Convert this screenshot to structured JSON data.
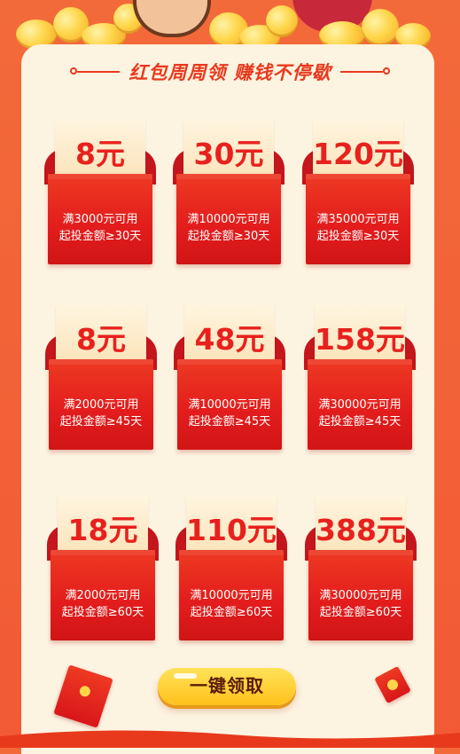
{
  "header": {
    "title": "红包周周领 赚钱不停歇"
  },
  "packets": [
    {
      "amount": "8元",
      "line1": "满3000元可用",
      "line2": "起投金额≥30天"
    },
    {
      "amount": "30元",
      "line1": "满10000元可用",
      "line2": "起投金额≥30天"
    },
    {
      "amount": "120元",
      "line1": "满35000元可用",
      "line2": "起投金额≥30天"
    },
    {
      "amount": "8元",
      "line1": "满2000元可用",
      "line2": "起投金额≥45天"
    },
    {
      "amount": "48元",
      "line1": "满10000元可用",
      "line2": "起投金额≥45天"
    },
    {
      "amount": "158元",
      "line1": "满30000元可用",
      "line2": "起投金额≥45天"
    },
    {
      "amount": "18元",
      "line1": "满2000元可用",
      "line2": "起投金额≥60天"
    },
    {
      "amount": "110元",
      "line1": "满10000元可用",
      "line2": "起投金额≥60天"
    },
    {
      "amount": "388元",
      "line1": "满30000元可用",
      "line2": "起投金额≥60天"
    }
  ],
  "actions": {
    "claim_label": "一键领取"
  },
  "colors": {
    "background": "#f15a35",
    "card": "#fdf3e1",
    "packet_red": "#e21c1c",
    "amount_red": "#e8211d",
    "button_yellow": "#ffc21b"
  },
  "icons": {
    "decor_left": "red-envelope-icon",
    "decor_right": "red-envelope-icon",
    "top_banner": "gold-coins-icon"
  }
}
